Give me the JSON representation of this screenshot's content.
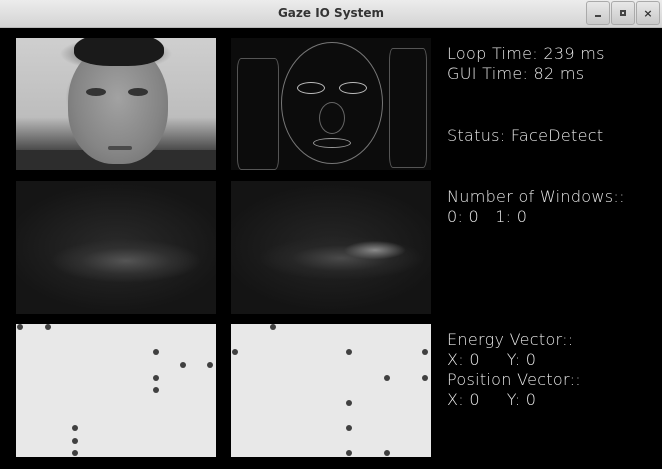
{
  "window": {
    "title": "Gaze IO System",
    "buttons": {
      "minimize": "_",
      "maximize": "□",
      "close": "×"
    }
  },
  "info": {
    "loop_time": "Loop Time: 239 ms",
    "gui_time": "GUI Time: 82 ms",
    "status": "Status: FaceDetect",
    "windows_title": "Number of Windows::",
    "windows_values": "0: 0   1: 0",
    "energy_title": "Energy Vector::",
    "energy_values": "X: 0     Y: 0",
    "position_title": "Position Vector::",
    "position_values": "X: 0     Y: 0"
  }
}
